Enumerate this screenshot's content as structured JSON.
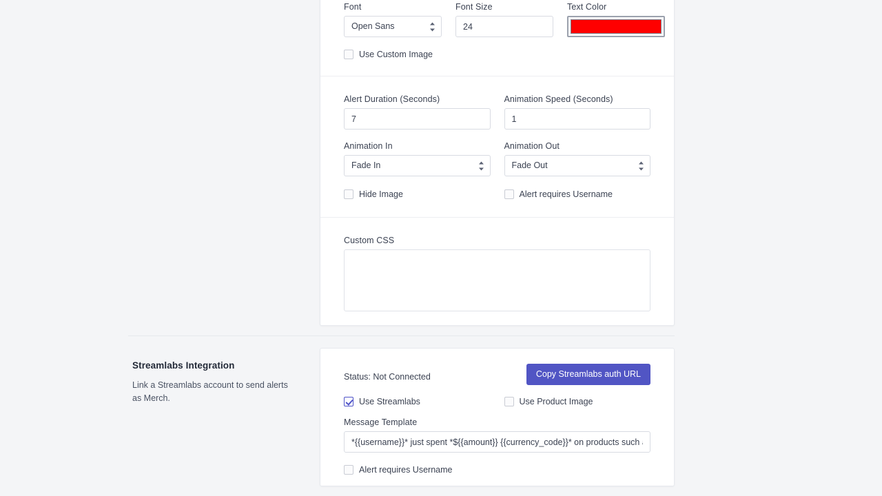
{
  "theme": {
    "page_bg": "#f4f5f7",
    "card_bg": "#ffffff",
    "accent": "#5155c4",
    "checkbox_accent": "#4f54c8",
    "text_color_value": "#ff0000"
  },
  "alert_settings": {
    "appearance": {
      "font": {
        "label": "Font",
        "value": "Open Sans",
        "options": [
          "Open Sans"
        ]
      },
      "font_size": {
        "label": "Font Size",
        "value": "24",
        "placeholder": ""
      },
      "text_color": {
        "label": "Text Color",
        "value": "#ff0000"
      },
      "use_custom_image": {
        "label": "Use Custom Image",
        "checked": false
      }
    },
    "timing": {
      "alert_duration": {
        "label": "Alert Duration (Seconds)",
        "value": "7",
        "placeholder": ""
      },
      "animation_speed": {
        "label": "Animation Speed (Seconds)",
        "value": "1",
        "placeholder": ""
      },
      "animation_in": {
        "label": "Animation In",
        "value": "Fade In",
        "options": [
          "Fade In"
        ]
      },
      "animation_out": {
        "label": "Animation Out",
        "value": "Fade Out",
        "options": [
          "Fade Out"
        ]
      },
      "hide_image": {
        "label": "Hide Image",
        "checked": false
      },
      "alert_requires_username": {
        "label": "Alert requires Username",
        "checked": false
      }
    },
    "custom_css": {
      "label": "Custom CSS",
      "value": "",
      "placeholder": ""
    }
  },
  "streamlabs": {
    "title": "Streamlabs Integration",
    "description": "Link a Streamlabs account to send alerts as Merch.",
    "status": "Status: Not Connected",
    "copy_auth_button": "Copy Streamlabs auth URL",
    "use_streamlabs": {
      "label": "Use Streamlabs",
      "checked": true
    },
    "use_product_image": {
      "label": "Use Product Image",
      "checked": false
    },
    "message_template": {
      "label": "Message Template",
      "value": "*{{username}}* just spent *${{amount}} {{currency_code}}* on products such as *{{prod",
      "placeholder": ""
    },
    "alert_requires_username": {
      "label": "Alert requires Username",
      "checked": false
    }
  }
}
